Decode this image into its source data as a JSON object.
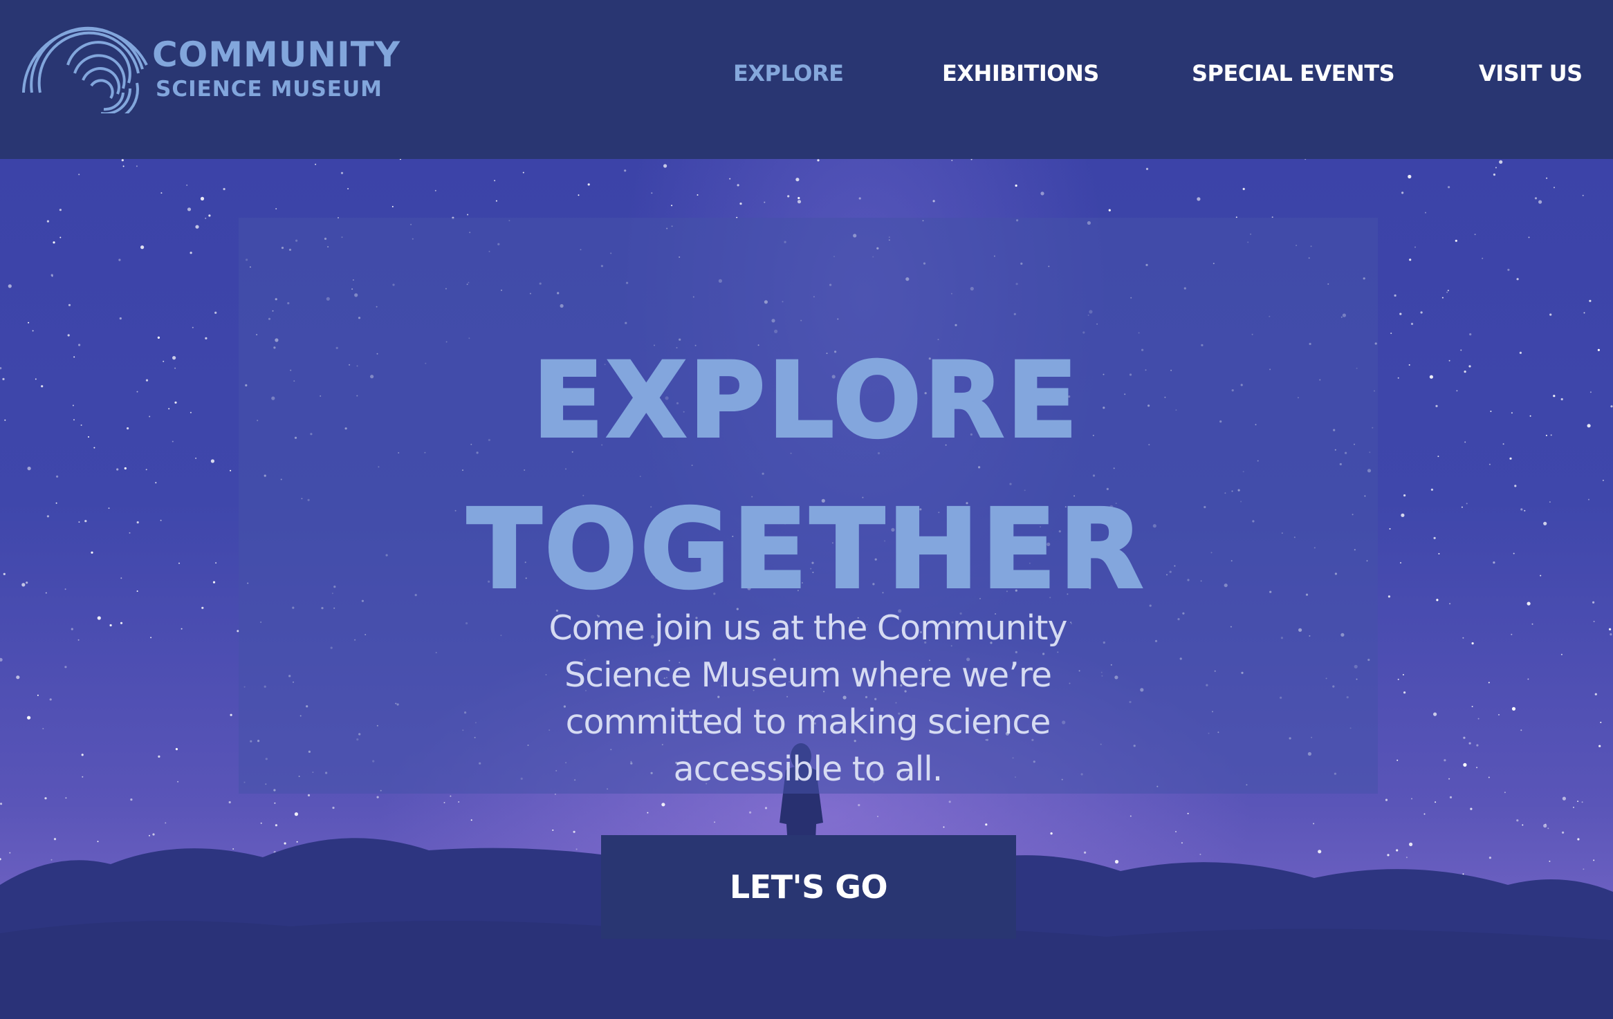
{
  "brand": {
    "name_line1": "COMMUNITY",
    "name_line2": "SCIENCE MUSEUM",
    "logo_icon": "concentric-arcs-icon",
    "color": "#82a6dc"
  },
  "nav": {
    "items": [
      {
        "label": "EXPLORE",
        "active": true
      },
      {
        "label": "EXHIBITIONS",
        "active": false
      },
      {
        "label": "SPECIAL EVENTS",
        "active": false
      },
      {
        "label": "VISIT US",
        "active": false
      }
    ]
  },
  "hero": {
    "headline_line1": "EXPLORE",
    "headline_line2": "TOGETHER",
    "body": "Come join us at the Community Science Museum where we’re committed to making science accessible to all.",
    "cta_label": "LET'S GO",
    "background": "starry-night-sky-with-silhouette"
  },
  "colors": {
    "header_bg": "#293672",
    "accent": "#83a6dd",
    "text_light": "#ffffff"
  }
}
